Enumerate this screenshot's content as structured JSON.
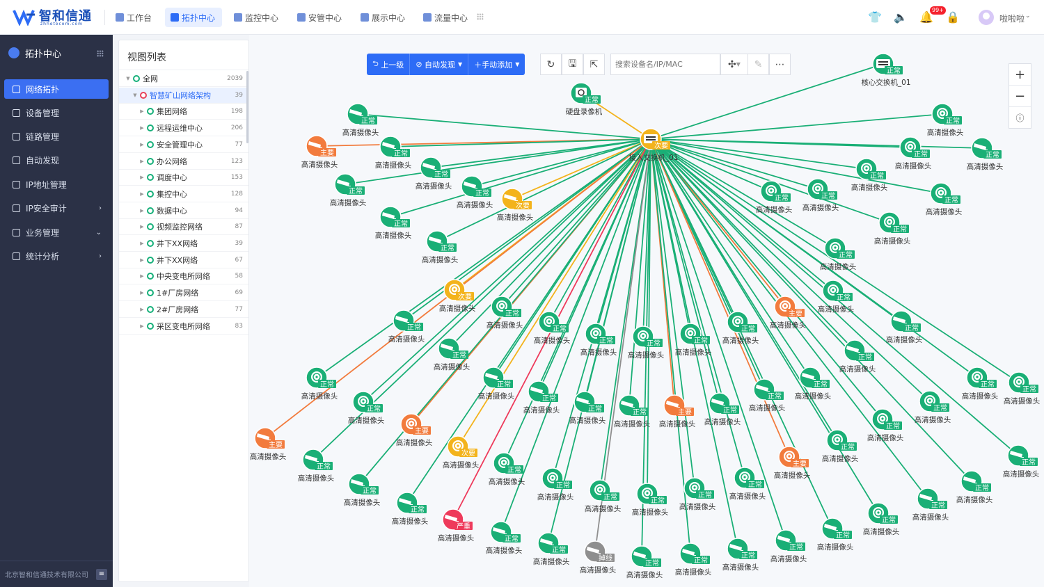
{
  "app": {
    "logo_text": "智和信通",
    "logo_sub": "zhhetecom.com",
    "user_name": "啦啦啦",
    "notification_count": "99+"
  },
  "nav": {
    "tabs": [
      {
        "label": "工作台",
        "icon": "desk-icon"
      },
      {
        "label": "拓扑中心",
        "icon": "topology-icon"
      },
      {
        "label": "监控中心",
        "icon": "monitor-icon"
      },
      {
        "label": "安管中心",
        "icon": "shield-icon"
      },
      {
        "label": "展示中心",
        "icon": "display-icon"
      },
      {
        "label": "流量中心",
        "icon": "traffic-icon"
      }
    ]
  },
  "sidebar": {
    "title": "拓扑中心",
    "items": [
      {
        "label": "网络拓扑",
        "icon": "network-icon",
        "has_arrow": ""
      },
      {
        "label": "设备管理",
        "icon": "device-icon",
        "has_arrow": ""
      },
      {
        "label": "链路管理",
        "icon": "link-icon",
        "has_arrow": ""
      },
      {
        "label": "自动发现",
        "icon": "discover-icon",
        "has_arrow": ""
      },
      {
        "label": "IP地址管理",
        "icon": "ip-icon",
        "has_arrow": ""
      },
      {
        "label": "IP安全审计",
        "icon": "audit-icon",
        "has_arrow": "›"
      },
      {
        "label": "业务管理",
        "icon": "business-icon",
        "has_arrow": "⌄"
      },
      {
        "label": "统计分析",
        "icon": "stats-icon",
        "has_arrow": "›"
      }
    ],
    "footer": "北京智和信通技术有限公司"
  },
  "panel": {
    "title": "视图列表",
    "tree": [
      {
        "label": "全网",
        "count": "2039",
        "level": 0,
        "caret": "▼",
        "color": "green"
      },
      {
        "label": "智慧矿山网络架构",
        "count": "39",
        "level": 1,
        "caret": "▼",
        "color": "red"
      },
      {
        "label": "集团网络",
        "count": "198",
        "level": 2,
        "caret": "▶",
        "color": "green"
      },
      {
        "label": "远程运维中心",
        "count": "206",
        "level": 2,
        "caret": "▶",
        "color": "green"
      },
      {
        "label": "安全管理中心",
        "count": "77",
        "level": 2,
        "caret": "▶",
        "color": "green"
      },
      {
        "label": "办公网络",
        "count": "123",
        "level": 2,
        "caret": "▶",
        "color": "green"
      },
      {
        "label": "调度中心",
        "count": "153",
        "level": 2,
        "caret": "▶",
        "color": "green"
      },
      {
        "label": "集控中心",
        "count": "128",
        "level": 2,
        "caret": "▶",
        "color": "green"
      },
      {
        "label": "数据中心",
        "count": "94",
        "level": 2,
        "caret": "▶",
        "color": "green"
      },
      {
        "label": "视频监控网络",
        "count": "87",
        "level": 2,
        "caret": "▶",
        "color": "green"
      },
      {
        "label": "井下XX网络",
        "count": "39",
        "level": 2,
        "caret": "▶",
        "color": "green"
      },
      {
        "label": "井下XX网络",
        "count": "67",
        "level": 2,
        "caret": "▶",
        "color": "green"
      },
      {
        "label": "中央变电所网络",
        "count": "58",
        "level": 2,
        "caret": "▶",
        "color": "green"
      },
      {
        "label": "1#厂房网络",
        "count": "69",
        "level": 2,
        "caret": "▶",
        "color": "green"
      },
      {
        "label": "2#厂房网络",
        "count": "77",
        "level": 2,
        "caret": "▶",
        "color": "green"
      },
      {
        "label": "采区变电所网络",
        "count": "83",
        "level": 2,
        "caret": "▶",
        "color": "green"
      }
    ]
  },
  "toolbar": {
    "up_label": "上一级",
    "auto_discover_label": "自动发现",
    "manual_add_label": "手动添加",
    "search_placeholder": "搜索设备名/IP/MAC"
  },
  "status_colors": {
    "正常": "#1aaf76",
    "次要": "#f3b31c",
    "主要": "#f27b3d",
    "严重": "#ee3a5b",
    "掉线": "#8f8f8f"
  },
  "topology": {
    "hub": {
      "name": "接入交换机_01",
      "status": "次要"
    },
    "core": {
      "name": "核心交换机_01",
      "status": "正常"
    },
    "nvr": {
      "name": "硬盘录像机",
      "status": "正常"
    },
    "camera_name": "高清摄像头"
  }
}
